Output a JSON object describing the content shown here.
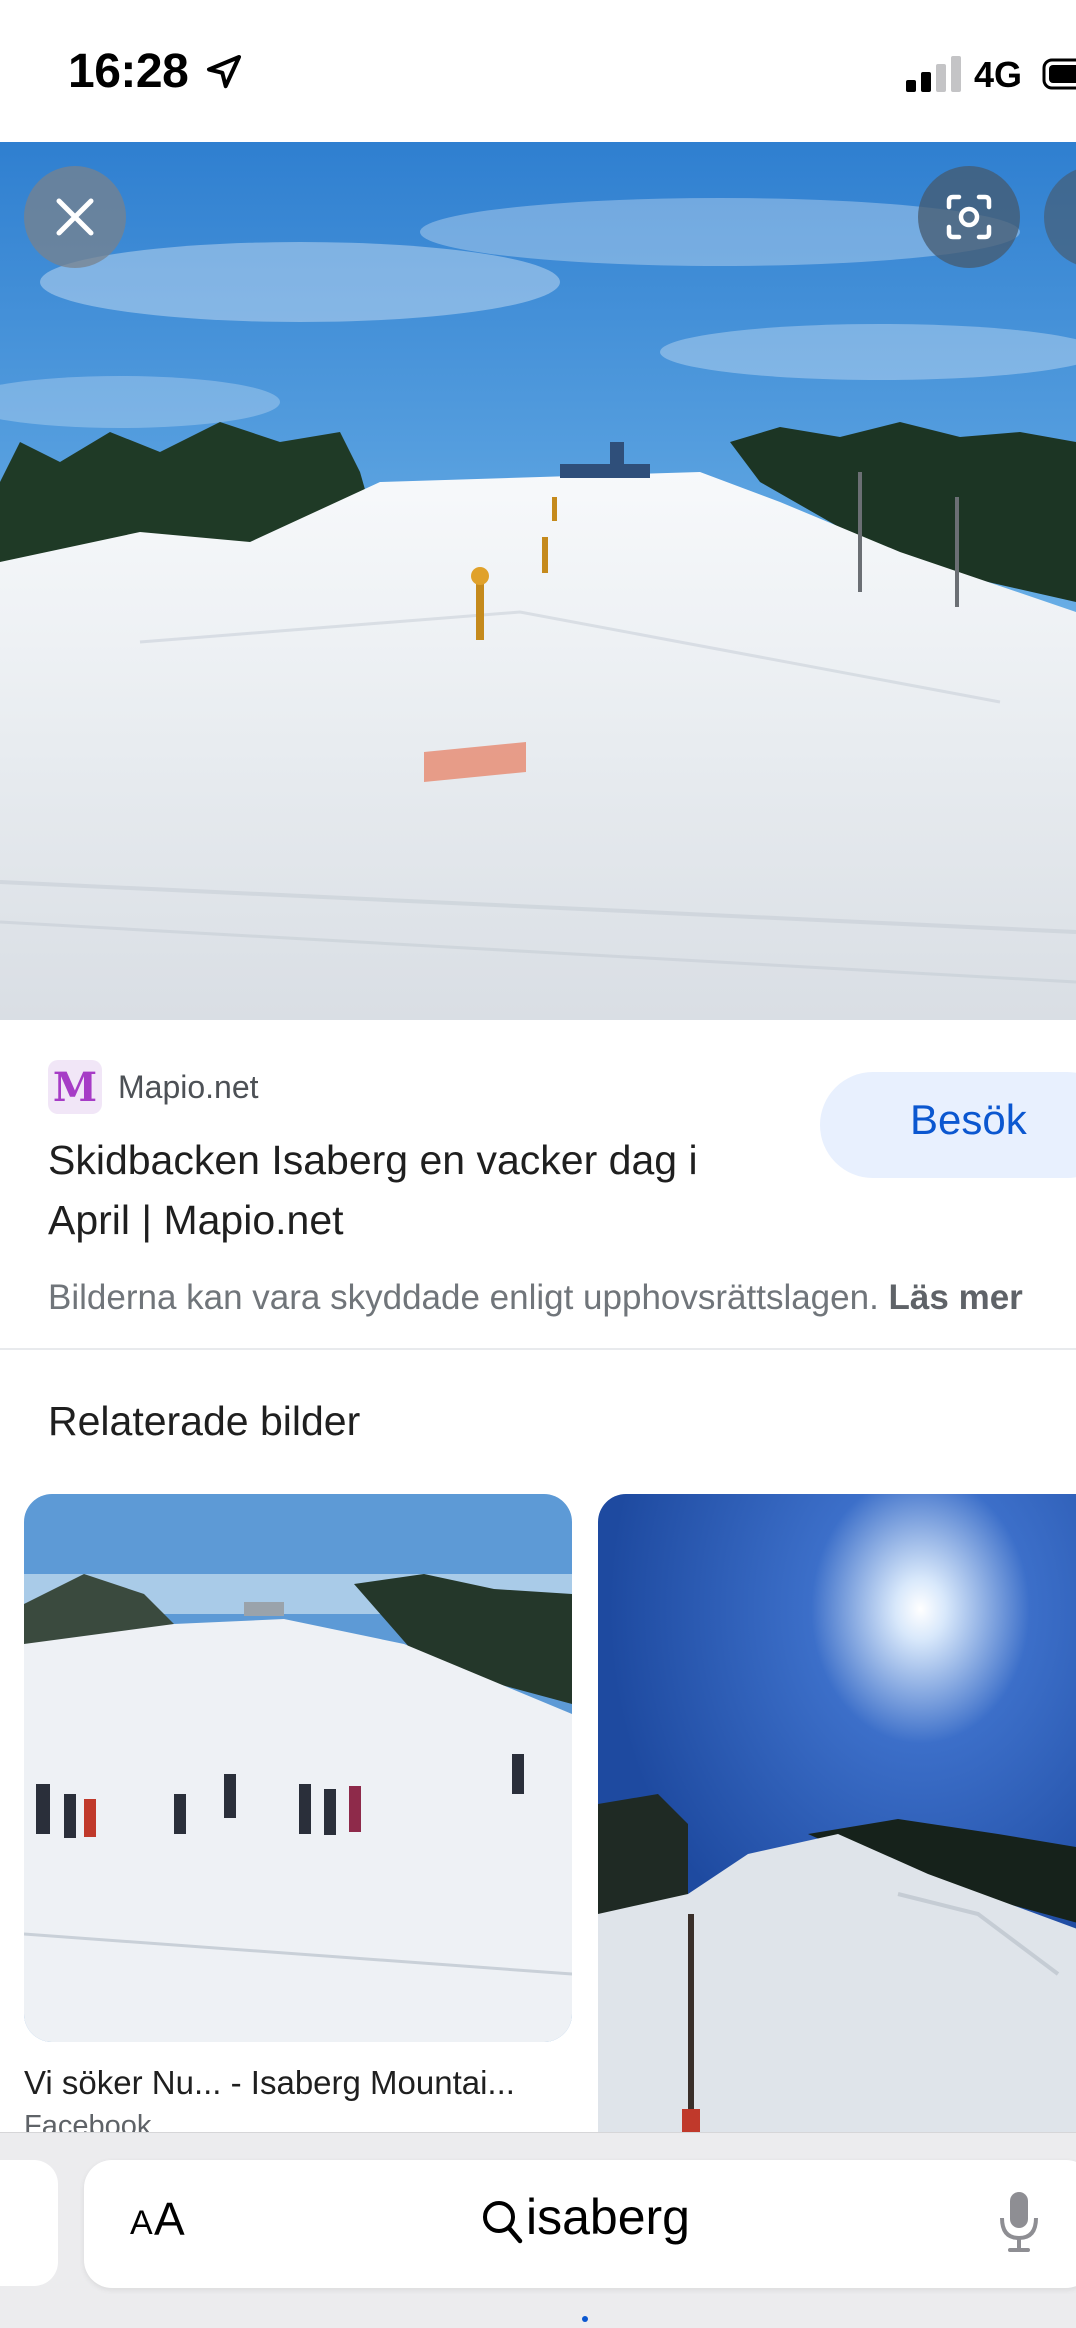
{
  "status_bar": {
    "time": "16:28",
    "network": "4G"
  },
  "viewer": {
    "close_icon": "close-icon",
    "lens_icon": "lens-icon"
  },
  "result": {
    "source_favicon": "M",
    "source_name": "Mapio.net",
    "visit_label": "Besök",
    "title": "Skidbacken Isaberg en vacker dag i April | Mapio.net",
    "disclaimer": "Bilderna kan vara skyddade enligt upphovsrättslagen.",
    "read_more": "Läs mer"
  },
  "related": {
    "heading": "Relaterade bilder",
    "items": [
      {
        "caption": "Vi söker Nu... - Isaberg Mountai...",
        "source": "Facebook"
      },
      {
        "caption": "",
        "source": ""
      }
    ]
  },
  "browser": {
    "aa_small": "A",
    "aa_large": "A",
    "address_text": "isaberg",
    "search_icon": "search-icon",
    "mic_icon": "mic-icon"
  },
  "colors": {
    "accent": "#0b57d0",
    "visit_bg": "#e8f0fe",
    "sky": "#3a8fd6",
    "snow": "#eef1f5"
  }
}
